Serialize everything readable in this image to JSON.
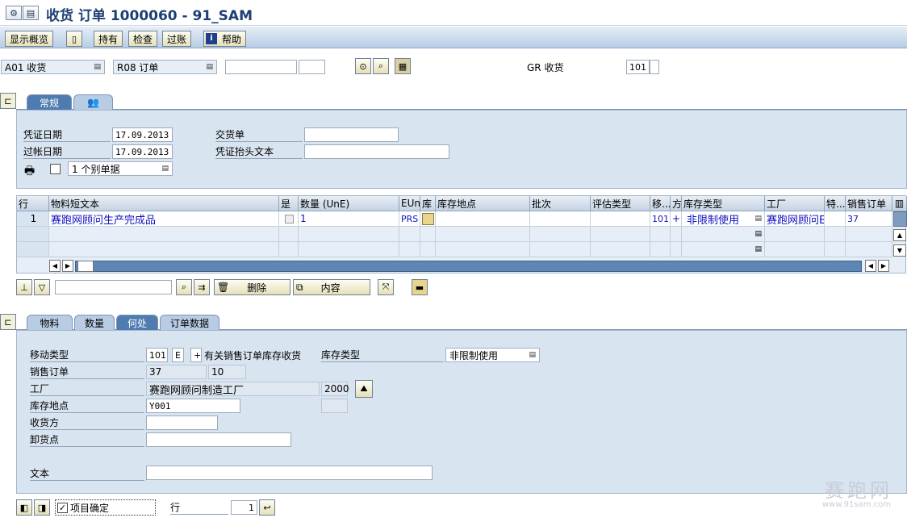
{
  "window": {
    "title": "收货 订单 1000060 - 91_SAM"
  },
  "toolbar": {
    "overview": "显示概览",
    "hold": "持有",
    "check": "检查",
    "post": "过账",
    "help": "帮助"
  },
  "header": {
    "action": "A01 收货",
    "reference": "R08 订单",
    "gr_label": "GR 收货",
    "gr_value": "101"
  },
  "tabs_top": [
    {
      "label": "常规"
    }
  ],
  "general": {
    "doc_date_label": "凭证日期",
    "doc_date": "17.09.2013",
    "post_date_label": "过帐日期",
    "post_date": "17.09.2013",
    "delivery_note_label": "交货单",
    "header_text_label": "凭证抬头文本",
    "print_option": "1 个别单据"
  },
  "grid": {
    "headers": [
      "行",
      "物料短文本",
      "是",
      "数量 (UnE)",
      "EUn",
      "库",
      "库存地点",
      "批次",
      "评估类型",
      "移...",
      "方",
      "库存类型",
      "工厂",
      "特...",
      "销售订单"
    ],
    "row": {
      "line": "1",
      "material": "赛跑网顾问生产完成品",
      "qty": "1",
      "unit": "PRS",
      "move": "101",
      "dir": "+",
      "stock_type": "非限制使用",
      "plant": "赛跑网顾问E",
      "sales_order": "37"
    }
  },
  "grid_toolbar": {
    "delete": "删除",
    "content": "内容"
  },
  "tabs_bottom": [
    {
      "label": "物料"
    },
    {
      "label": "数量"
    },
    {
      "label": "何处"
    },
    {
      "label": "订单数据"
    }
  ],
  "where": {
    "move_type_label": "移动类型",
    "move_type": "101",
    "move_ind": "E",
    "move_sign": "+",
    "move_desc": "有关销售订单库存收货",
    "stock_type_label": "库存类型",
    "stock_type": "非限制使用",
    "sales_order_label": "销售订单",
    "sales_order": "37",
    "sales_item": "10",
    "plant_label": "工厂",
    "plant_name": "赛跑网顾问制造工厂",
    "plant_code": "2000",
    "sloc_label": "库存地点",
    "sloc": "Y001",
    "recipient_label": "收货方",
    "unload_label": "卸货点",
    "text_label": "文本"
  },
  "footer": {
    "item_ok": "项目确定",
    "line_label": "行",
    "line_value": "1"
  },
  "watermark": {
    "text": "赛跑网",
    "url": "www.91sam.com"
  }
}
